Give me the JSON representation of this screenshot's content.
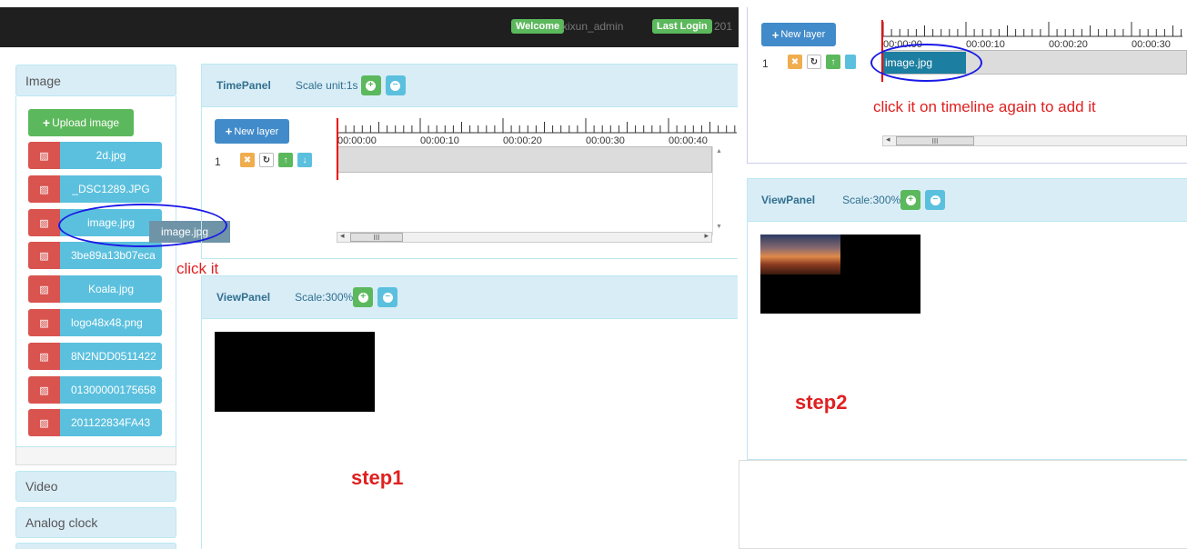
{
  "topbar": {
    "welcome_label": "Welcome",
    "username": "xixun_admin",
    "last_login_label": "Last Login",
    "last_login_value": "201"
  },
  "sidebar": {
    "sections": {
      "image": "Image",
      "video": "Video",
      "analog_clock": "Analog clock"
    },
    "upload_label": "Upload image",
    "files": [
      "2d.jpg",
      "_DSC1289.JPG",
      "image.jpg",
      "3be89a13b07eca",
      "Koala.jpg",
      "logo48x48.png",
      "8N2NDD0511422",
      "01300000175658",
      "201122834FA43"
    ],
    "drag_ghost": "image.jpg"
  },
  "timepanel": {
    "title": "TimePanel",
    "scale_label": "Scale unit:1s",
    "new_layer_label": "New layer",
    "layer_number": "1",
    "ticks": [
      "00:00:00",
      "00:00:10",
      "00:00:20",
      "00:00:30",
      "00:00:40"
    ],
    "scroll_glyph": "III"
  },
  "viewpanel": {
    "title": "ViewPanel",
    "scale_label": "Scale:300%"
  },
  "step2_timeline": {
    "new_layer_label": "New layer",
    "layer_number": "1",
    "ticks": [
      "00:00:00",
      "00:00:10",
      "00:00:20",
      "00:00:30"
    ],
    "clip_label": "image.jpg",
    "scroll_glyph": "III"
  },
  "step2_viewpanel": {
    "title": "ViewPanel",
    "scale_label": "Scale:300%"
  },
  "annotations": {
    "click_it": "click it",
    "click_again": "click it on timeline again to add it",
    "step1": "step1",
    "step2": "step2"
  },
  "colors": {
    "annotation_red": "#e02020",
    "oval_blue": "#1a1ae6",
    "panel_blue": "#d9edf7",
    "success_green": "#5cb85c",
    "info_blue": "#5bc0de",
    "danger_red": "#d9534f"
  }
}
